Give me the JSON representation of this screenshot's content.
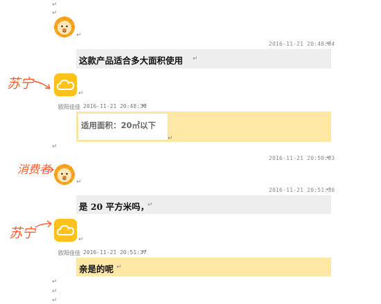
{
  "colors": {
    "customer_bubble": "#eeeeee",
    "agent_bubble": "#ffe7a6",
    "annotation": "#ff5a2c",
    "brand_yellow": "#ffc21a"
  },
  "paragraph_mark": "↵",
  "messages": [
    {
      "role": "customer",
      "timestamp": "2016-11-21 20:48:04",
      "text": "这款产品适合多大面积使用"
    },
    {
      "role": "agent",
      "annotation": "苏宁",
      "name": "欧阳佳佳",
      "timestamp": "2016-11-21 20:48:30",
      "text": "适用面积：20㎡以下"
    },
    {
      "role": "customer",
      "annotation": "消费者",
      "timestamp": "2016-11-21 20:50:03",
      "timestamp2": "2016-11-21 20:51:30",
      "text": "是 20 平方米吗，"
    },
    {
      "role": "agent",
      "annotation": "苏宁",
      "name": "欧阳佳佳",
      "timestamp": "2016-11-21 20:51:37",
      "text": "亲是的呢"
    }
  ]
}
